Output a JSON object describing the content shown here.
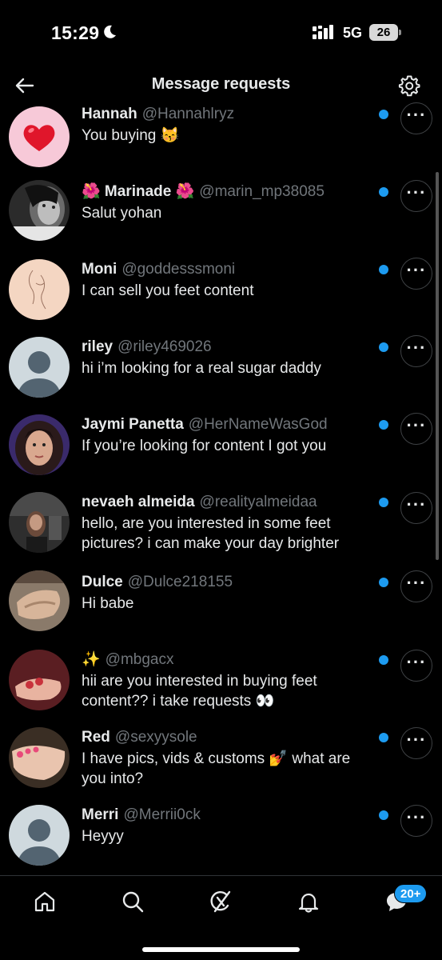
{
  "status_bar": {
    "time": "15:29",
    "network": "5G",
    "battery": "26",
    "icons": [
      "moon-icon",
      "signal-icon",
      "battery-icon"
    ]
  },
  "header": {
    "title": "Message requests",
    "back_icon": "arrow-left-icon",
    "settings_icon": "gear-icon"
  },
  "requests": [
    {
      "name": "Hannah",
      "handle": "@Hannahlryz",
      "message": "You buying 😽",
      "unread": true,
      "avatar": "heart-avatar"
    },
    {
      "name": "🌺 Marinade 🌺",
      "handle": "@marin_mp38085",
      "message": "Salut yohan",
      "unread": true,
      "avatar": "photo-avatar"
    },
    {
      "name": "Moni",
      "handle": "@goddesssmoni",
      "message": "I can sell you feet content",
      "unread": true,
      "avatar": "line-art-avatar"
    },
    {
      "name": "riley",
      "handle": "@riley469026",
      "message": "hi i’m looking for a real sugar daddy",
      "unread": true,
      "avatar": "default-avatar"
    },
    {
      "name": "Jaymi Panetta",
      "handle": "@HerNameWasGod",
      "message": "If you’re looking for content I got you",
      "unread": true,
      "avatar": "photo-avatar"
    },
    {
      "name": "nevaeh almeida",
      "handle": "@realityalmeidaa",
      "message": "hello, are you interested in some feet pictures? i can make your day brighter",
      "unread": true,
      "avatar": "photo-avatar"
    },
    {
      "name": "Dulce",
      "handle": "@Dulce218155",
      "message": "Hi babe",
      "unread": true,
      "avatar": "photo-avatar"
    },
    {
      "name": "✨",
      "handle": "@mbgacx",
      "message": "hii are you interested in buying feet content?? i take requests 👀",
      "unread": true,
      "avatar": "photo-avatar"
    },
    {
      "name": "Red",
      "handle": "@sexyysole",
      "message": "I have pics, vids & customs 💅 what are you into?",
      "unread": true,
      "avatar": "photo-avatar"
    },
    {
      "name": "Merri",
      "handle": "@Merrii0ck",
      "message": "Heyyy",
      "unread": true,
      "avatar": "default-avatar"
    }
  ],
  "bottom_nav": {
    "items": [
      "home-icon",
      "search-icon",
      "grok-icon",
      "notifications-icon",
      "messages-icon"
    ],
    "messages_badge": "20+"
  },
  "colors": {
    "background": "#000000",
    "accent": "#1d9bf0",
    "text": "#e7e9ea",
    "secondary_text": "#71767b"
  }
}
